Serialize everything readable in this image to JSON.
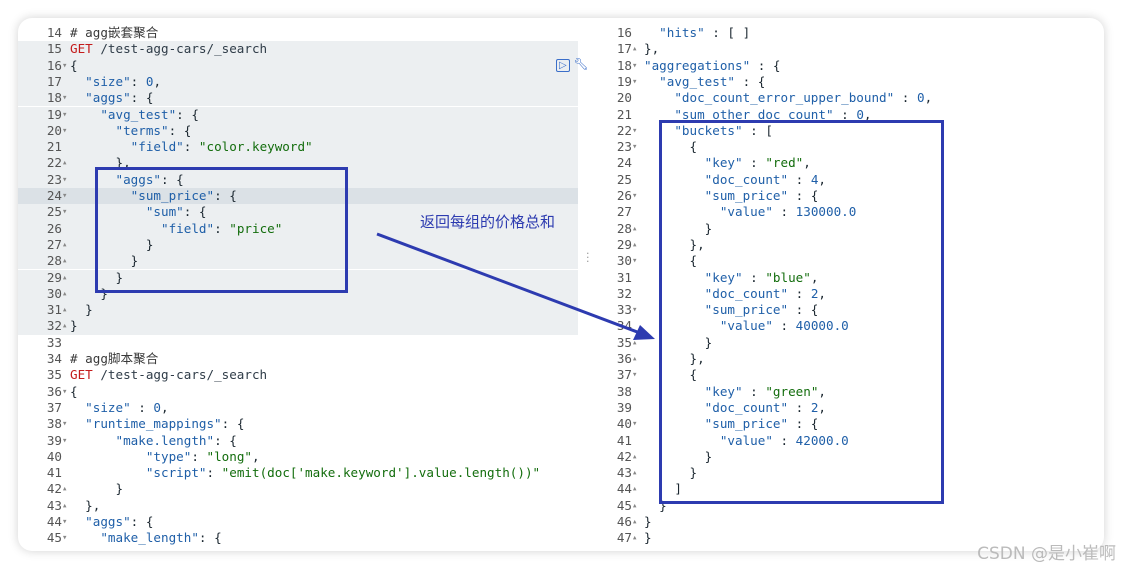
{
  "left_lines": [
    {
      "n": "14",
      "f": "",
      "t": [
        [
          "# agg嵌套聚合",
          "cm"
        ]
      ],
      "bg": ""
    },
    {
      "n": "15",
      "f": "",
      "t": [
        [
          "GET",
          "m"
        ],
        [
          " /test-agg-cars/_search",
          "u"
        ]
      ],
      "bg": "hl"
    },
    {
      "n": "16",
      "f": "▾",
      "t": [
        [
          "{",
          "p"
        ]
      ],
      "bg": "hl"
    },
    {
      "n": "17",
      "f": "",
      "t": [
        [
          "  \"size\"",
          "k"
        ],
        [
          ": ",
          "p"
        ],
        [
          "0",
          "n"
        ],
        [
          ",",
          "p"
        ]
      ],
      "bg": "hl"
    },
    {
      "n": "18",
      "f": "▾",
      "t": [
        [
          "  \"aggs\"",
          "k"
        ],
        [
          ": {",
          "p"
        ]
      ],
      "bg": "hl"
    },
    {
      "n": "19",
      "f": "▾",
      "t": [
        [
          "    \"avg_test\"",
          "k"
        ],
        [
          ": {",
          "p"
        ]
      ],
      "bg": "hl"
    },
    {
      "n": "20",
      "f": "▾",
      "t": [
        [
          "      \"terms\"",
          "k"
        ],
        [
          ": {",
          "p"
        ]
      ],
      "bg": "hl"
    },
    {
      "n": "21",
      "f": "",
      "t": [
        [
          "        \"field\"",
          "k"
        ],
        [
          ": ",
          "p"
        ],
        [
          "\"color.keyword\"",
          "s"
        ]
      ],
      "bg": "hl"
    },
    {
      "n": "22",
      "f": "▴",
      "t": [
        [
          "      },",
          "p"
        ]
      ],
      "bg": "hl"
    },
    {
      "n": "23",
      "f": "▾",
      "t": [
        [
          "      \"aggs\"",
          "k"
        ],
        [
          ": {",
          "p"
        ]
      ],
      "bg": "hl"
    },
    {
      "n": "24",
      "f": "▾",
      "t": [
        [
          "        \"sum_price\"",
          "k"
        ],
        [
          ": {",
          "p"
        ]
      ],
      "bg": "act"
    },
    {
      "n": "25",
      "f": "▾",
      "t": [
        [
          "          \"sum\"",
          "k"
        ],
        [
          ": {",
          "p"
        ]
      ],
      "bg": "hl"
    },
    {
      "n": "26",
      "f": "",
      "t": [
        [
          "            \"field\"",
          "k"
        ],
        [
          ": ",
          "p"
        ],
        [
          "\"price\"",
          "s"
        ]
      ],
      "bg": "hl"
    },
    {
      "n": "27",
      "f": "▴",
      "t": [
        [
          "          }",
          "p"
        ]
      ],
      "bg": "hl"
    },
    {
      "n": "28",
      "f": "▴",
      "t": [
        [
          "        }",
          "p"
        ]
      ],
      "bg": "hl"
    },
    {
      "n": "29",
      "f": "▴",
      "t": [
        [
          "      }",
          "p"
        ]
      ],
      "bg": "hl"
    },
    {
      "n": "30",
      "f": "▴",
      "t": [
        [
          "    }",
          "p"
        ]
      ],
      "bg": "hl"
    },
    {
      "n": "31",
      "f": "▴",
      "t": [
        [
          "  }",
          "p"
        ]
      ],
      "bg": "hl"
    },
    {
      "n": "32",
      "f": "▴",
      "t": [
        [
          "}",
          "p"
        ]
      ],
      "bg": "hl"
    },
    {
      "n": "33",
      "f": "",
      "t": [],
      "bg": ""
    },
    {
      "n": "34",
      "f": "",
      "t": [
        [
          "# agg脚本聚合",
          "cm"
        ]
      ],
      "bg": ""
    },
    {
      "n": "35",
      "f": "",
      "t": [
        [
          "GET",
          "m"
        ],
        [
          " /test-agg-cars/_search",
          "u"
        ]
      ],
      "bg": ""
    },
    {
      "n": "36",
      "f": "▾",
      "t": [
        [
          "{",
          "p"
        ]
      ],
      "bg": ""
    },
    {
      "n": "37",
      "f": "",
      "t": [
        [
          "  \"size\"",
          "k"
        ],
        [
          " : ",
          "p"
        ],
        [
          "0",
          "n"
        ],
        [
          ",",
          "p"
        ]
      ],
      "bg": ""
    },
    {
      "n": "38",
      "f": "▾",
      "t": [
        [
          "  \"runtime_mappings\"",
          "k"
        ],
        [
          ": {",
          "p"
        ]
      ],
      "bg": ""
    },
    {
      "n": "39",
      "f": "▾",
      "t": [
        [
          "      \"make.length\"",
          "k"
        ],
        [
          ": {",
          "p"
        ]
      ],
      "bg": ""
    },
    {
      "n": "40",
      "f": "",
      "t": [
        [
          "          \"type\"",
          "k"
        ],
        [
          ": ",
          "p"
        ],
        [
          "\"long\"",
          "s"
        ],
        [
          ",",
          "p"
        ]
      ],
      "bg": ""
    },
    {
      "n": "41",
      "f": "",
      "t": [
        [
          "          \"script\"",
          "k"
        ],
        [
          ": ",
          "p"
        ],
        [
          "\"emit(doc['make.keyword'].value.length())\"",
          "s"
        ]
      ],
      "bg": ""
    },
    {
      "n": "42",
      "f": "▴",
      "t": [
        [
          "      }",
          "p"
        ]
      ],
      "bg": ""
    },
    {
      "n": "43",
      "f": "▴",
      "t": [
        [
          "  },",
          "p"
        ]
      ],
      "bg": ""
    },
    {
      "n": "44",
      "f": "▾",
      "t": [
        [
          "  \"aggs\"",
          "k"
        ],
        [
          ": {",
          "p"
        ]
      ],
      "bg": ""
    },
    {
      "n": "45",
      "f": "▾",
      "t": [
        [
          "    \"make_length\"",
          "k"
        ],
        [
          ": {",
          "p"
        ]
      ],
      "bg": ""
    }
  ],
  "right_lines": [
    {
      "n": "16",
      "f": "",
      "t": [
        [
          "  \"hits\"",
          "k"
        ],
        [
          " : [ ]",
          "p"
        ]
      ]
    },
    {
      "n": "17",
      "f": "▴",
      "t": [
        [
          "},",
          "p"
        ]
      ]
    },
    {
      "n": "18",
      "f": "▾",
      "t": [
        [
          "\"aggregations\"",
          "k"
        ],
        [
          " : {",
          "p"
        ]
      ]
    },
    {
      "n": "19",
      "f": "▾",
      "t": [
        [
          "  \"avg_test\"",
          "k"
        ],
        [
          " : {",
          "p"
        ]
      ]
    },
    {
      "n": "20",
      "f": "",
      "t": [
        [
          "    \"doc_count_error_upper_bound\"",
          "k"
        ],
        [
          " : ",
          "p"
        ],
        [
          "0",
          "n"
        ],
        [
          ",",
          "p"
        ]
      ]
    },
    {
      "n": "21",
      "f": "",
      "t": [
        [
          "    \"sum_other_doc_count\"",
          "k"
        ],
        [
          " : ",
          "p"
        ],
        [
          "0",
          "n"
        ],
        [
          ",",
          "p"
        ]
      ]
    },
    {
      "n": "22",
      "f": "▾",
      "t": [
        [
          "    \"buckets\"",
          "k"
        ],
        [
          " : [",
          "p"
        ]
      ]
    },
    {
      "n": "23",
      "f": "▾",
      "t": [
        [
          "      {",
          "p"
        ]
      ]
    },
    {
      "n": "24",
      "f": "",
      "t": [
        [
          "        \"key\"",
          "k"
        ],
        [
          " : ",
          "p"
        ],
        [
          "\"red\"",
          "s"
        ],
        [
          ",",
          "p"
        ]
      ]
    },
    {
      "n": "25",
      "f": "",
      "t": [
        [
          "        \"doc_count\"",
          "k"
        ],
        [
          " : ",
          "p"
        ],
        [
          "4",
          "n"
        ],
        [
          ",",
          "p"
        ]
      ]
    },
    {
      "n": "26",
      "f": "▾",
      "t": [
        [
          "        \"sum_price\"",
          "k"
        ],
        [
          " : {",
          "p"
        ]
      ]
    },
    {
      "n": "27",
      "f": "",
      "t": [
        [
          "          \"value\"",
          "k"
        ],
        [
          " : ",
          "p"
        ],
        [
          "130000.0",
          "n"
        ]
      ]
    },
    {
      "n": "28",
      "f": "▴",
      "t": [
        [
          "        }",
          "p"
        ]
      ]
    },
    {
      "n": "29",
      "f": "▴",
      "t": [
        [
          "      },",
          "p"
        ]
      ]
    },
    {
      "n": "30",
      "f": "▾",
      "t": [
        [
          "      {",
          "p"
        ]
      ]
    },
    {
      "n": "31",
      "f": "",
      "t": [
        [
          "        \"key\"",
          "k"
        ],
        [
          " : ",
          "p"
        ],
        [
          "\"blue\"",
          "s"
        ],
        [
          ",",
          "p"
        ]
      ]
    },
    {
      "n": "32",
      "f": "",
      "t": [
        [
          "        \"doc_count\"",
          "k"
        ],
        [
          " : ",
          "p"
        ],
        [
          "2",
          "n"
        ],
        [
          ",",
          "p"
        ]
      ]
    },
    {
      "n": "33",
      "f": "▾",
      "t": [
        [
          "        \"sum_price\"",
          "k"
        ],
        [
          " : {",
          "p"
        ]
      ]
    },
    {
      "n": "34",
      "f": "",
      "t": [
        [
          "          \"value\"",
          "k"
        ],
        [
          " : ",
          "p"
        ],
        [
          "40000.0",
          "n"
        ]
      ]
    },
    {
      "n": "35",
      "f": "▴",
      "t": [
        [
          "        }",
          "p"
        ]
      ]
    },
    {
      "n": "36",
      "f": "▴",
      "t": [
        [
          "      },",
          "p"
        ]
      ]
    },
    {
      "n": "37",
      "f": "▾",
      "t": [
        [
          "      {",
          "p"
        ]
      ]
    },
    {
      "n": "38",
      "f": "",
      "t": [
        [
          "        \"key\"",
          "k"
        ],
        [
          " : ",
          "p"
        ],
        [
          "\"green\"",
          "s"
        ],
        [
          ",",
          "p"
        ]
      ]
    },
    {
      "n": "39",
      "f": "",
      "t": [
        [
          "        \"doc_count\"",
          "k"
        ],
        [
          " : ",
          "p"
        ],
        [
          "2",
          "n"
        ],
        [
          ",",
          "p"
        ]
      ]
    },
    {
      "n": "40",
      "f": "▾",
      "t": [
        [
          "        \"sum_price\"",
          "k"
        ],
        [
          " : {",
          "p"
        ]
      ]
    },
    {
      "n": "41",
      "f": "",
      "t": [
        [
          "          \"value\"",
          "k"
        ],
        [
          " : ",
          "p"
        ],
        [
          "42000.0",
          "n"
        ]
      ]
    },
    {
      "n": "42",
      "f": "▴",
      "t": [
        [
          "        }",
          "p"
        ]
      ]
    },
    {
      "n": "43",
      "f": "▴",
      "t": [
        [
          "      }",
          "p"
        ]
      ]
    },
    {
      "n": "44",
      "f": "▴",
      "t": [
        [
          "    ]",
          "p"
        ]
      ]
    },
    {
      "n": "45",
      "f": "▴",
      "t": [
        [
          "  }",
          "p"
        ]
      ]
    },
    {
      "n": "46",
      "f": "▴",
      "t": [
        [
          "}",
          "p"
        ]
      ]
    },
    {
      "n": "47",
      "f": "▴",
      "t": [
        [
          "}",
          "p"
        ]
      ]
    }
  ],
  "annotation": "返回每组的价格总和",
  "watermark": "CSDN @是小崔啊",
  "toolbar_icons": [
    "play-icon",
    "wrench-icon"
  ],
  "colors": {
    "annotation_box": "#2d3bb0",
    "keyword": "#1f5fa8",
    "string": "#136d0d",
    "method": "#c41b1b"
  }
}
